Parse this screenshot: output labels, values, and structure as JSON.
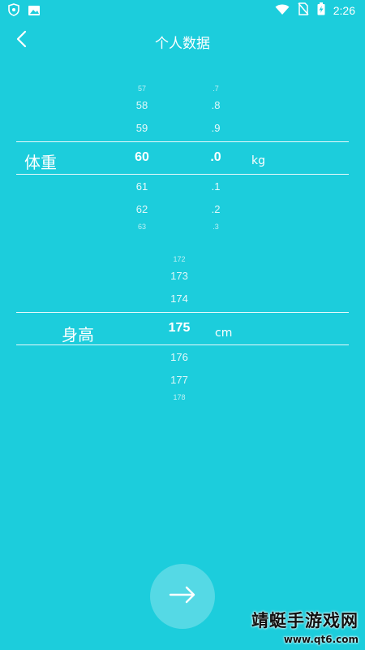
{
  "status_bar": {
    "time": "2:26",
    "left_icons": [
      "shield-icon",
      "image-icon"
    ],
    "right_icons": [
      "wifi-icon",
      "no-sim-icon",
      "battery-charging-icon"
    ]
  },
  "header": {
    "title": "个人数据",
    "back_icon": "chevron-left-icon"
  },
  "weight": {
    "label": "体重",
    "unit": "kg",
    "integer_values": [
      "57",
      "58",
      "59",
      "60",
      "61",
      "62",
      "63"
    ],
    "decimal_values": [
      ".7",
      ".8",
      ".9",
      ".0",
      ".1",
      ".2",
      ".3"
    ],
    "selected_integer": "60",
    "selected_decimal": ".0"
  },
  "height": {
    "label": "身高",
    "unit": "cm",
    "values": [
      "172",
      "173",
      "174",
      "175",
      "176",
      "177",
      "178"
    ],
    "selected": "175"
  },
  "next_button": {
    "icon": "arrow-right-icon"
  },
  "watermark": {
    "line1": "靖蜓手游戏网",
    "line2": "www.qt6.com"
  },
  "colors": {
    "background": "#1ccddc",
    "foreground": "#ffffff"
  }
}
